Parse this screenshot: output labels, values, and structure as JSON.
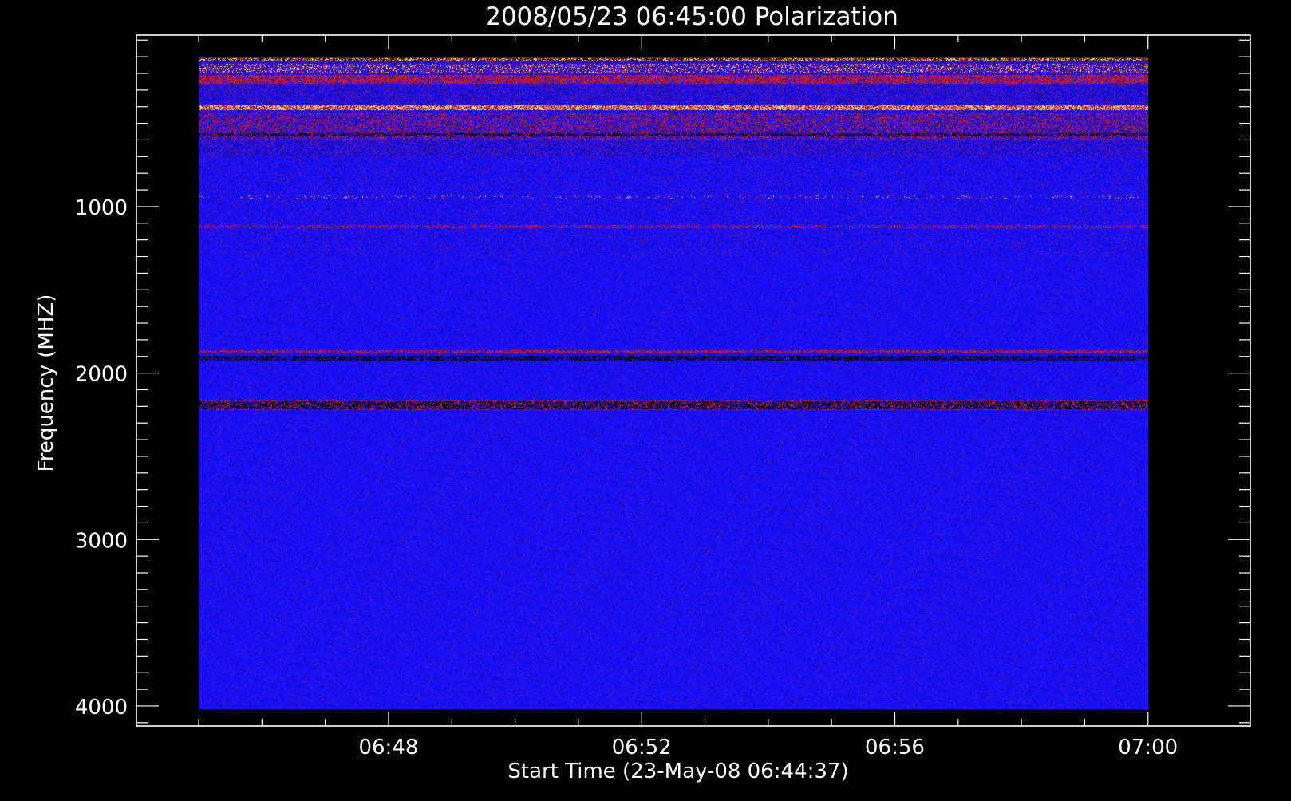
{
  "chart_data": {
    "type": "heatmap",
    "title": "2008/05/23 06:45:00 Polarization",
    "xlabel": "Start Time (23-May-08 06:44:37)",
    "ylabel": "Frequency (MHZ)",
    "x_tick_labels": [
      "06:48",
      "06:52",
      "06:56",
      "07:00"
    ],
    "x_tick_minutes": [
      3.3833,
      7.3833,
      11.3833,
      15.3833
    ],
    "x_range_minutes": [
      -0.6,
      17.0
    ],
    "data_x_range_minutes": [
      0.3833,
      15.3833
    ],
    "y_ticks": [
      1000,
      2000,
      3000,
      4000
    ],
    "y_tick_labels": [
      "1000",
      "2000",
      "3000",
      "4000"
    ],
    "y_range": [
      -30,
      4120
    ],
    "data_y_range": [
      100,
      4020
    ],
    "reversed_y": true,
    "colormap": {
      "background": "#1a10f4",
      "low": "#000000",
      "mid": "#d01e1e",
      "high": "#ffe070"
    },
    "features": [
      {
        "kind": "band",
        "y": [
          105,
          120
        ],
        "intensity": "mixed",
        "coverage": 0.9
      },
      {
        "kind": "band",
        "y": [
          140,
          200
        ],
        "intensity": "high",
        "coverage": 0.3
      },
      {
        "kind": "band",
        "y": [
          210,
          260
        ],
        "intensity": "red",
        "coverage": 0.6
      },
      {
        "kind": "band",
        "y": [
          390,
          420
        ],
        "intensity": "high",
        "coverage": 0.85
      },
      {
        "kind": "band",
        "y": [
          440,
          600
        ],
        "intensity": "red",
        "coverage": 0.25
      },
      {
        "kind": "band",
        "y": [
          560,
          575
        ],
        "intensity": "low",
        "coverage": 0.5
      },
      {
        "kind": "band",
        "y": [
          930,
          950
        ],
        "intensity": "high",
        "coverage": 0.08
      },
      {
        "kind": "band",
        "y": [
          1110,
          1130
        ],
        "intensity": "red",
        "coverage": 0.35
      },
      {
        "kind": "band",
        "y": [
          1860,
          1880
        ],
        "intensity": "red",
        "coverage": 0.5
      },
      {
        "kind": "band",
        "y": [
          1895,
          1925
        ],
        "intensity": "low",
        "coverage": 0.55
      },
      {
        "kind": "band",
        "y": [
          2160,
          2220
        ],
        "intensity": "red",
        "coverage": 0.4
      },
      {
        "kind": "band",
        "y": [
          2170,
          2215
        ],
        "intensity": "low",
        "coverage": 0.5
      }
    ]
  }
}
